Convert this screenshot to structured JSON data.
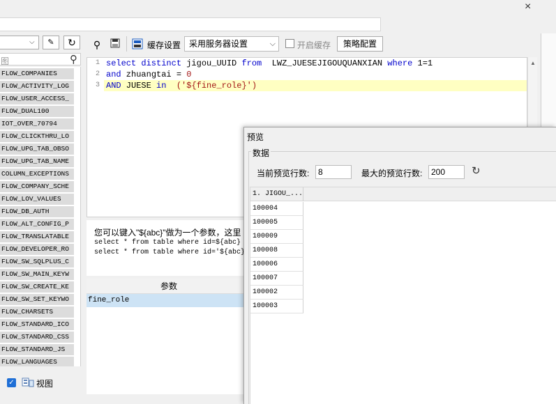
{
  "window": {
    "close_glyph": "×"
  },
  "left_panel": {
    "search_placeholder": "图",
    "tables": [
      "FLOW_COMPANIES",
      "FLOW_ACTIVITY_LOG",
      "FLOW_USER_ACCESS_",
      "FLOW_DUAL100",
      "IOT_OVER_70794",
      "FLOW_CLICKTHRU_LO",
      "FLOW_UPG_TAB_OBSO",
      "FLOW_UPG_TAB_NAME",
      "COLUMN_EXCEPTIONS",
      "FLOW_COMPANY_SCHE",
      "FLOW_LOV_VALUES",
      "FLOW_DB_AUTH",
      "FLOW_ALT_CONFIG_P",
      "FLOW_TRANSLATABLE",
      "FLOW_DEVELOPER_RO",
      "FLOW_SW_SQLPLUS_C",
      "FLOW_SW_MAIN_KEYW",
      "FLOW_SW_CREATE_KE",
      "FLOW_SW_SET_KEYWO",
      "FLOW_CHARSETS",
      "FLOW_STANDARD_ICO",
      "FLOW_STANDARD_CSS",
      "FLOW_STANDARD_JS",
      "FLOW_LANGUAGES"
    ],
    "view_label": "视图"
  },
  "toolbar": {
    "cache_label": "缓存设置",
    "cache_select_value": "采用服务器设置",
    "enable_cache_label": "开启缓存",
    "strategy_button": "策略配置"
  },
  "editor": {
    "line_numbers": [
      "1",
      "2",
      "3"
    ],
    "line1": {
      "kw1": "select distinct",
      "plain1": " jigou_UUID ",
      "kw2": "from",
      "plain2": "  LWZ_JUESEJIGOUQUANXIAN ",
      "kw3": "where",
      "plain3": " 1=1"
    },
    "line2": {
      "kw1": "and",
      "plain1": " zhuangtai = ",
      "num": "0"
    },
    "line3": {
      "kw1": "AND",
      "plain1": " JUESE ",
      "kw2": "in",
      "plain2": "  ",
      "str": "('${fine_role}')"
    }
  },
  "hint": {
    "text": "您可以键入\"${abc}\"做为一个参数，这里",
    "example1": "select * from table where id=${abc}",
    "example2": "select * from table where id='${abc}'"
  },
  "params": {
    "header": "参数",
    "rows": [
      "fine_role"
    ]
  },
  "preview": {
    "title": "预览",
    "group_label": "数据",
    "current_rows_label": "当前预览行数:",
    "current_rows_value": "8",
    "max_rows_label": "最大的预览行数:",
    "max_rows_value": "200",
    "column_header": "1. JIGOU_...",
    "rows": [
      "100004",
      "100005",
      "100009",
      "100008",
      "100006",
      "100007",
      "100002",
      "100003"
    ]
  }
}
